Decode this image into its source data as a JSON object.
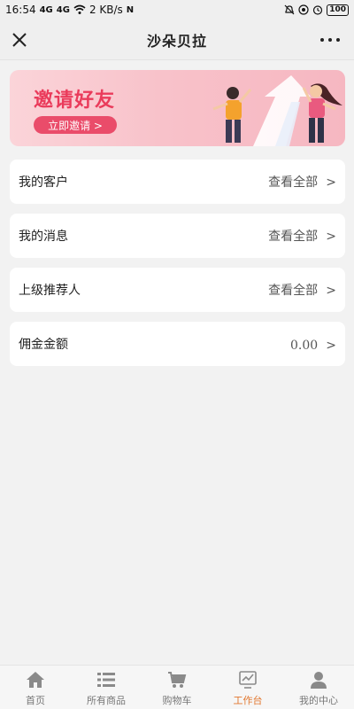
{
  "status_bar": {
    "time": "16:54",
    "signal_1": "4G",
    "signal_2": "4G",
    "speed": "2 KB/s",
    "nfc": "N",
    "battery": "100"
  },
  "nav": {
    "title": "沙朵贝拉"
  },
  "banner": {
    "title": "邀请好友",
    "button_label": "立即邀请 >"
  },
  "cards": [
    {
      "label": "我的客户",
      "value": "查看全部",
      "arrow": ">"
    },
    {
      "label": "我的消息",
      "value": "查看全部",
      "arrow": ">"
    },
    {
      "label": "上级推荐人",
      "value": "查看全部",
      "arrow": ">"
    },
    {
      "label": "佣金金额",
      "value": "0.00",
      "arrow": ">"
    }
  ],
  "tabs": [
    {
      "label": "首页",
      "icon": "home-icon"
    },
    {
      "label": "所有商品",
      "icon": "list-icon"
    },
    {
      "label": "购物车",
      "icon": "cart-icon"
    },
    {
      "label": "工作台",
      "icon": "chart-icon",
      "active": true
    },
    {
      "label": "我的中心",
      "icon": "user-icon"
    }
  ],
  "colors": {
    "accent": "#e2772f",
    "banner_text": "#ea3b5b",
    "banner_button": "#ea4c6a"
  }
}
